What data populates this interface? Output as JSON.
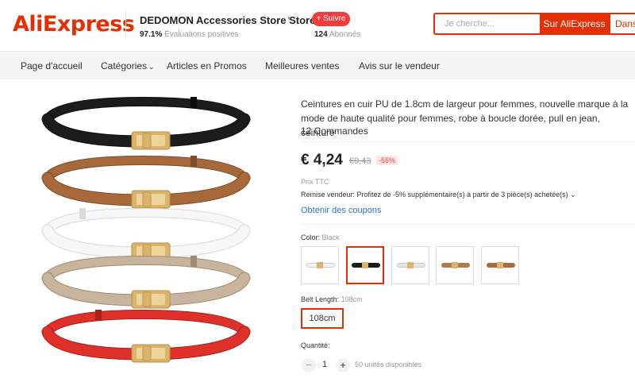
{
  "header": {
    "logo": "AliExpress",
    "store_name": "DEDOMON Accessories Store Store",
    "store_rating_value": "97.1%",
    "store_rating_text": "Évaluations positives",
    "follow_label": "+ Suivre",
    "followers_count": "124",
    "followers_text": "Abonnés",
    "search_placeholder": "Je cherche...",
    "search_button": "Sur AliExpress",
    "search_button2": "Dans"
  },
  "nav": {
    "items": [
      {
        "label": "Page d'accueil"
      },
      {
        "label": "Catégories"
      },
      {
        "label": "Articles en Promos"
      },
      {
        "label": "Meilleures ventes"
      },
      {
        "label": "Avis sur le vendeur"
      }
    ]
  },
  "product": {
    "title": "Ceintures en cuir PU de 1.8cm de largeur pour femmes, nouvelle marque à la mode de haute qualité pour femmes, robe à boucle dorée, pull en jean, ceinture",
    "orders": "12 Commandes",
    "price": "€ 4,24",
    "old_price": "€9,43",
    "discount": "-55%",
    "prix_ttc": "Prix TTC",
    "remise": "Remise vendeur: Profitez de -5% supplémentaire(s) à partir de 3 pièce(s) achetée(s) ⌄",
    "coupons": "Obtenir des coupons",
    "color_label": "Color:",
    "color_value": "Black",
    "swatches": [
      {
        "color": "#f2f2f2"
      },
      {
        "color": "#1a1a1a"
      },
      {
        "color": "#e9e9e9"
      },
      {
        "color": "#a86b3c"
      },
      {
        "color": "#a86b3c"
      }
    ],
    "length_label": "Belt Length:",
    "length_value": "108cm",
    "length_option": "108cm",
    "qty_label": "Quantité:",
    "qty_value": "1",
    "qty_avail": "50 unités disponibles"
  },
  "belts": [
    {
      "color": "#1c1c1c",
      "edge": "#0d0d0d"
    },
    {
      "color": "#a8693a",
      "edge": "#7d4c28"
    },
    {
      "color": "#f7f7f7",
      "edge": "#d9d9d9"
    },
    {
      "color": "#c8b49c",
      "edge": "#a08b72"
    },
    {
      "color": "#e0302a",
      "edge": "#a81f1b"
    }
  ],
  "colors": {
    "accent": "#e62e04",
    "link": "#2e73c8",
    "gold": "#d9b46a"
  }
}
